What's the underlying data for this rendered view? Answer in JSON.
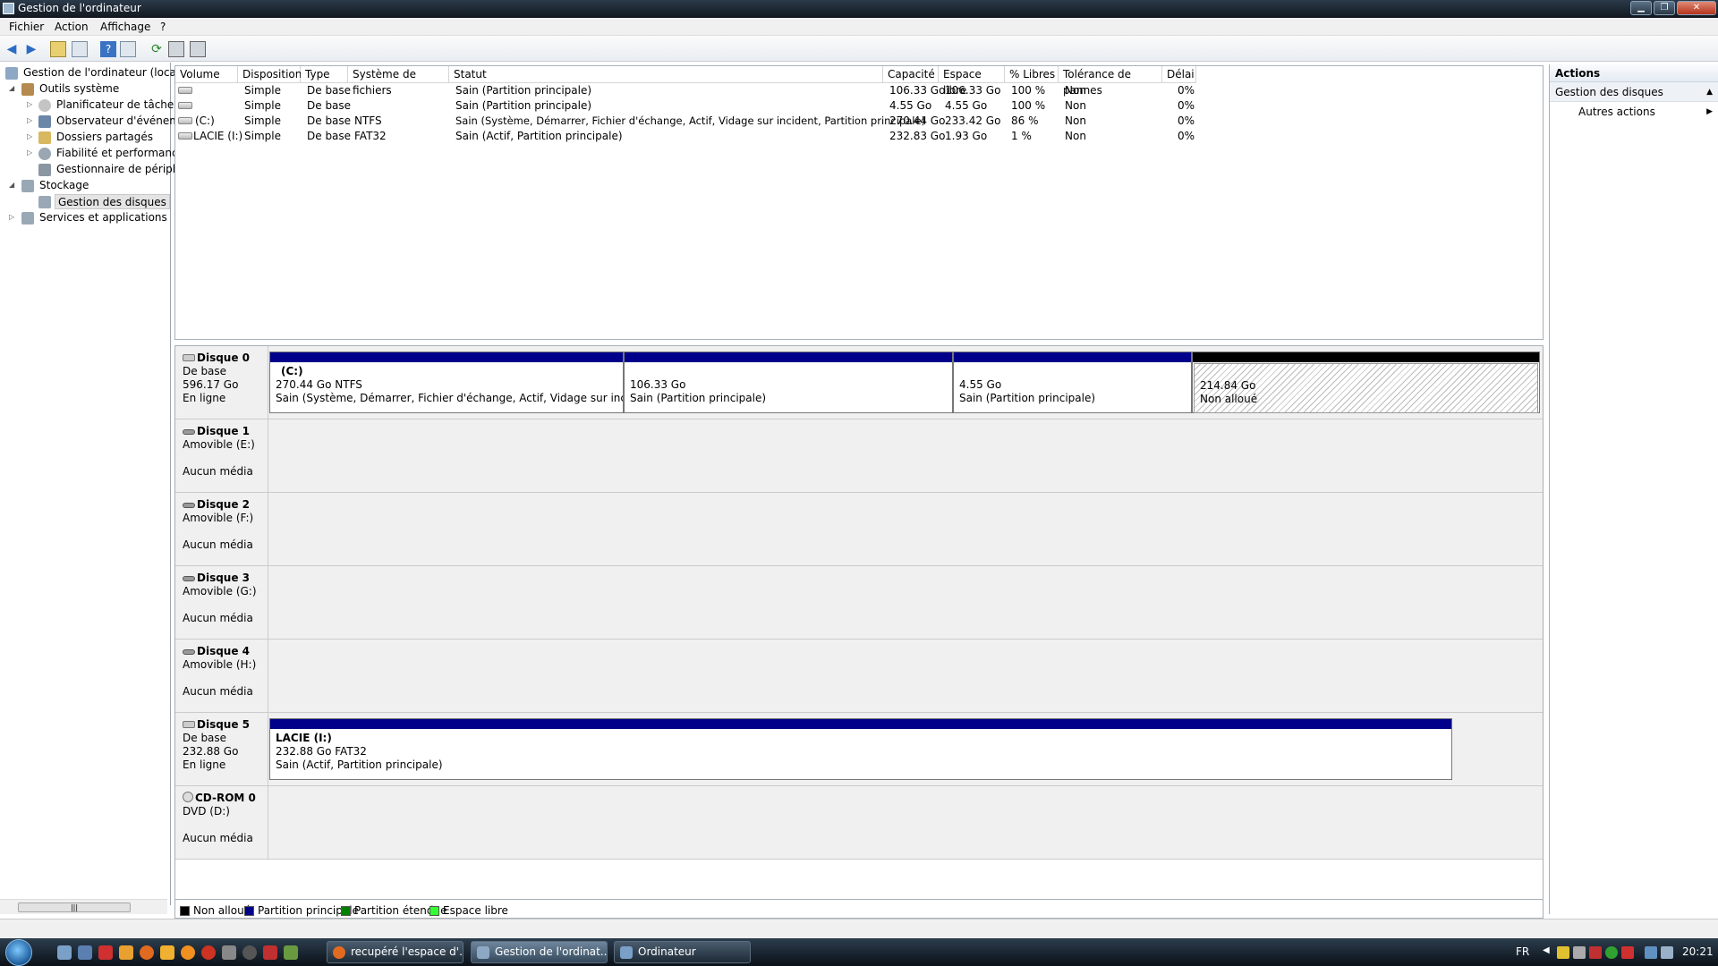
{
  "window": {
    "title": "Gestion de l'ordinateur"
  },
  "menu": [
    "Fichier",
    "Action",
    "Affichage",
    "?"
  ],
  "tree": {
    "root": "Gestion de l'ordinateur (local)",
    "outils": "Outils système",
    "planificateur": "Planificateur de tâches",
    "observateur": "Observateur d'événeme",
    "dossiers": "Dossiers partagés",
    "fiabilite": "Fiabilité et performance",
    "gestionnaire": "Gestionnaire de périphé",
    "stockage": "Stockage",
    "gestion_disques": "Gestion des disques",
    "services": "Services et applications"
  },
  "volumes": {
    "columns": [
      "Volume",
      "Disposition",
      "Type",
      "Système de fichiers",
      "Statut",
      "Capacité",
      "Espace libre",
      "% Libres",
      "Tolérance de pannes",
      "Délai"
    ],
    "rows": [
      {
        "volume": "",
        "disposition": "Simple",
        "type": "De base",
        "fs": "",
        "statut": "Sain (Partition principale)",
        "capacite": "106.33 Go",
        "libre": "106.33 Go",
        "pct": "100 %",
        "tolerance": "Non",
        "delai": "0%"
      },
      {
        "volume": "",
        "disposition": "Simple",
        "type": "De base",
        "fs": "",
        "statut": "Sain (Partition principale)",
        "capacite": "4.55 Go",
        "libre": "4.55 Go",
        "pct": "100 %",
        "tolerance": "Non",
        "delai": "0%"
      },
      {
        "volume": "(C:)",
        "disposition": "Simple",
        "type": "De base",
        "fs": "NTFS",
        "statut": "Sain (Système, Démarrer, Fichier d'échange, Actif, Vidage sur incident, Partition principale)",
        "capacite": "270.44 Go",
        "libre": "233.42 Go",
        "pct": "86 %",
        "tolerance": "Non",
        "delai": "0%"
      },
      {
        "volume": "LACIE (I:)",
        "disposition": "Simple",
        "type": "De base",
        "fs": "FAT32",
        "statut": "Sain (Actif, Partition principale)",
        "capacite": "232.83 Go",
        "libre": "1.93 Go",
        "pct": "1 %",
        "tolerance": "Non",
        "delai": "0%"
      }
    ]
  },
  "disks": {
    "d0": {
      "name": "Disque 0",
      "l1": "De base",
      "l2": "596.17 Go",
      "l3": "En ligne",
      "p1": {
        "label": "(C:)",
        "size": "270.44 Go NTFS",
        "status": "Sain (Système, Démarrer, Fichier d'échange, Actif, Vidage sur incident, Pa"
      },
      "p2": {
        "size": "106.33 Go",
        "status": "Sain (Partition principale)"
      },
      "p3": {
        "size": "4.55 Go",
        "status": "Sain (Partition principale)"
      },
      "p4": {
        "size": "214.84 Go",
        "status": "Non alloué"
      }
    },
    "d1": {
      "name": "Disque 1",
      "l1": "Amovible (E:)",
      "l3": "Aucun média"
    },
    "d2": {
      "name": "Disque 2",
      "l1": "Amovible (F:)",
      "l3": "Aucun média"
    },
    "d3": {
      "name": "Disque 3",
      "l1": "Amovible (G:)",
      "l3": "Aucun média"
    },
    "d4": {
      "name": "Disque 4",
      "l1": "Amovible (H:)",
      "l3": "Aucun média"
    },
    "d5": {
      "name": "Disque 5",
      "l1": "De base",
      "l2": "232.88 Go",
      "l3": "En ligne",
      "p1": {
        "label": "LACIE  (I:)",
        "size": "232.88 Go FAT32",
        "status": "Sain (Actif, Partition principale)"
      }
    },
    "cd0": {
      "name": "CD-ROM 0",
      "l1": "DVD (D:)",
      "l3": "Aucun média"
    }
  },
  "legend": {
    "non_alloue": "Non alloué",
    "principale": "Partition principale",
    "etendue": "Partition étendue",
    "libre": "Espace libre",
    "colors": {
      "non_alloue": "#000000",
      "principale": "#00008b",
      "etendue": "#008000",
      "libre": "#33ff33"
    }
  },
  "actions": {
    "header": "Actions",
    "section": "Gestion des disques",
    "more": "Autres actions"
  },
  "taskbar": {
    "tasks": [
      "recupéré l'espace d'...",
      "Gestion de l'ordinat...",
      "Ordinateur"
    ],
    "lang": "FR",
    "clock": "20:21"
  }
}
